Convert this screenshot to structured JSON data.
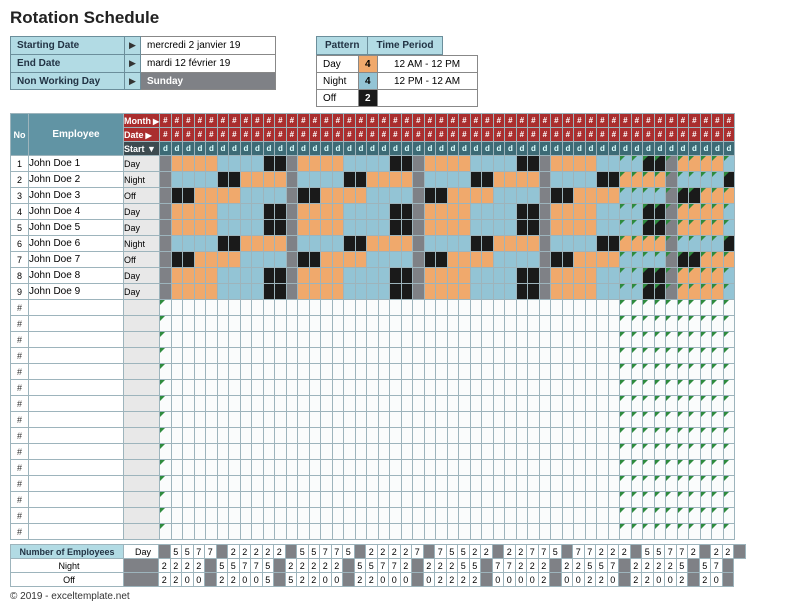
{
  "title": "Rotation Schedule",
  "info": {
    "start_label": "Starting Date",
    "start_val": "mercredi 2 janvier 19",
    "end_label": "End Date",
    "end_val": "mardi 12 février 19",
    "nwd_label": "Non Working Day",
    "nwd_val": "Sunday"
  },
  "pattern": {
    "hdr_pattern": "Pattern",
    "hdr_period": "Time Period",
    "rows": [
      {
        "label": "Day",
        "count": "4",
        "cls": "orange",
        "period": "12 AM - 12 PM"
      },
      {
        "label": "Night",
        "count": "4",
        "cls": "blue",
        "period": "12 PM - 12 AM"
      },
      {
        "label": "Off",
        "count": "2",
        "cls": "black",
        "period": ""
      }
    ]
  },
  "hdr": {
    "no": "No",
    "employee": "Employee",
    "month": "Month",
    "date": "Date",
    "start": "Start",
    "hash": "#",
    "d": "d",
    "tri": "▶",
    "tridown": "▼"
  },
  "cols": 50,
  "gray_cols_schedule": [
    0,
    11,
    22,
    33,
    44
  ],
  "employees": [
    {
      "no": "1",
      "name": "John Doe 1",
      "start": "Day",
      "offset": 0
    },
    {
      "no": "2",
      "name": "John Doe 2",
      "start": "Night",
      "offset": 4
    },
    {
      "no": "3",
      "name": "John Doe 3",
      "start": "Off",
      "offset": 8
    },
    {
      "no": "4",
      "name": "John Doe 4",
      "start": "Day",
      "offset": 0
    },
    {
      "no": "5",
      "name": "John Doe 5",
      "start": "Day",
      "offset": 0
    },
    {
      "no": "6",
      "name": "John Doe 6",
      "start": "Night",
      "offset": 4
    },
    {
      "no": "7",
      "name": "John Doe 7",
      "start": "Off",
      "offset": 8
    },
    {
      "no": "8",
      "name": "John Doe 8",
      "start": "Day",
      "offset": 0
    },
    {
      "no": "9",
      "name": "John Doe 9",
      "start": "Day",
      "offset": 0
    }
  ],
  "empty_rows": 15,
  "summary": {
    "label": "Number of Employees",
    "rows": [
      {
        "label": "Day",
        "vals": [
          "",
          "5",
          "5",
          "7",
          "7",
          "",
          "2",
          "2",
          "2",
          "2",
          "2",
          "",
          "5",
          "5",
          "7",
          "7",
          "5",
          "",
          "2",
          "2",
          "2",
          "2",
          "7",
          "",
          "7",
          "5",
          "5",
          "2",
          "2",
          "",
          "2",
          "2",
          "7",
          "7",
          "5",
          "",
          "7",
          "7",
          "2",
          "2",
          "2",
          "",
          "5",
          "5",
          "7",
          "7",
          "2",
          "",
          "2",
          "2",
          ""
        ]
      },
      {
        "label": "Night",
        "vals": [
          "",
          "2",
          "2",
          "2",
          "2",
          "",
          "5",
          "5",
          "7",
          "7",
          "5",
          "",
          "2",
          "2",
          "2",
          "2",
          "2",
          "",
          "5",
          "5",
          "7",
          "7",
          "2",
          "",
          "2",
          "2",
          "2",
          "5",
          "5",
          "",
          "7",
          "7",
          "2",
          "2",
          "2",
          "",
          "2",
          "2",
          "5",
          "5",
          "7",
          "",
          "2",
          "2",
          "2",
          "2",
          "5",
          "",
          "5",
          "7",
          ""
        ]
      },
      {
        "label": "Off",
        "vals": [
          "",
          "2",
          "2",
          "0",
          "0",
          "",
          "2",
          "2",
          "0",
          "0",
          "5",
          "",
          "5",
          "2",
          "2",
          "0",
          "0",
          "",
          "2",
          "2",
          "0",
          "0",
          "0",
          "",
          "0",
          "2",
          "2",
          "2",
          "2",
          "",
          "0",
          "0",
          "0",
          "0",
          "2",
          "",
          "0",
          "0",
          "2",
          "2",
          "0",
          "",
          "2",
          "2",
          "0",
          "0",
          "2",
          "",
          "2",
          "0",
          ""
        ]
      }
    ]
  },
  "copyright": "© 2019 - exceltemplate.net"
}
